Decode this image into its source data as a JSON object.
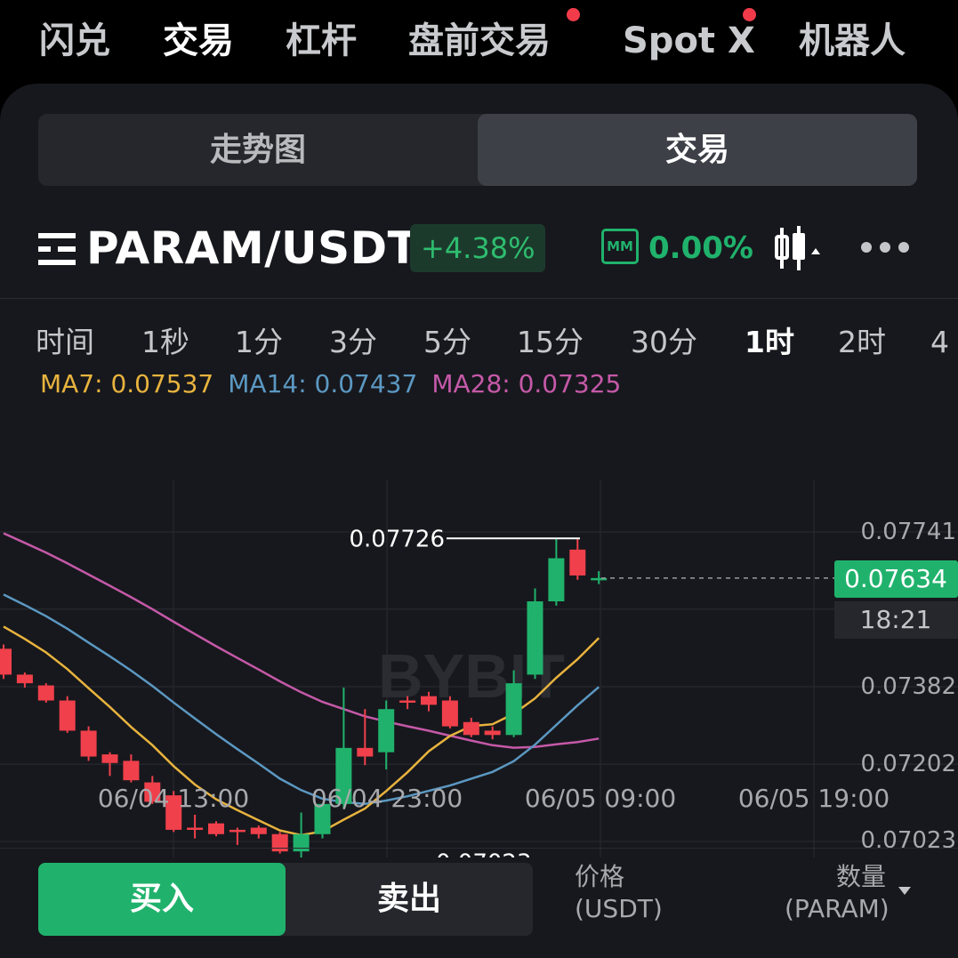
{
  "topnav": {
    "tabs": [
      {
        "label": "闪兑",
        "active": false,
        "dot": false
      },
      {
        "label": "交易",
        "active": true,
        "dot": false
      },
      {
        "label": "杠杆",
        "active": false,
        "dot": false
      },
      {
        "label": "盘前交易",
        "active": false,
        "dot": true
      },
      {
        "label": "Spot X",
        "active": false,
        "dot": true
      },
      {
        "label": "机器人",
        "active": false,
        "dot": false
      }
    ]
  },
  "segment": {
    "left": "走势图",
    "right": "交易",
    "selected": "交易"
  },
  "symbol": {
    "pair": "PARAM/USDT",
    "change": "+4.38%",
    "mm_label": "MM",
    "mm_value": "0.00%"
  },
  "intervals": {
    "items": [
      "时间",
      "1秒",
      "1分",
      "3分",
      "5分",
      "15分",
      "30分",
      "1时",
      "2时",
      "4"
    ],
    "selected": "1时"
  },
  "ma": {
    "ma7": "MA7: 0.07537",
    "ma14": "MA14: 0.07437",
    "ma28": "MA28: 0.07325",
    "colors": {
      "ma7": "#e8b33e",
      "ma14": "#5b98c2",
      "ma28": "#c559a8"
    }
  },
  "colors": {
    "up": "#20b26c",
    "down": "#f0404b",
    "accent_green": "#20b26c"
  },
  "chart_data": {
    "type": "candlestick",
    "price_axis_labels": [
      "0.07741",
      "0.07382",
      "0.07202",
      "0.07023"
    ],
    "current_price": "0.07634",
    "countdown": "18:21",
    "high_marker": "0.07726",
    "low_marker": "0.07023",
    "time_labels": [
      "06/04 13:00",
      "06/04 23:00",
      "06/05 09:00",
      "06/05 19:00"
    ],
    "watermark": "BYBIT",
    "candles": [
      {
        "o": 0.0747,
        "h": 0.0748,
        "c": 0.0741,
        "l": 0.074
      },
      {
        "o": 0.0741,
        "h": 0.07415,
        "c": 0.0739,
        "l": 0.0738
      },
      {
        "o": 0.07385,
        "h": 0.0739,
        "c": 0.0735,
        "l": 0.07345
      },
      {
        "o": 0.0735,
        "h": 0.0736,
        "c": 0.0728,
        "l": 0.07275
      },
      {
        "o": 0.0728,
        "h": 0.0729,
        "c": 0.0722,
        "l": 0.0721
      },
      {
        "o": 0.07225,
        "h": 0.0723,
        "c": 0.07205,
        "l": 0.07175
      },
      {
        "o": 0.0721,
        "h": 0.07225,
        "c": 0.07165,
        "l": 0.0716
      },
      {
        "o": 0.0716,
        "h": 0.07175,
        "c": 0.07115,
        "l": 0.0711
      },
      {
        "o": 0.0713,
        "h": 0.0714,
        "c": 0.0705,
        "l": 0.07045
      },
      {
        "o": 0.07055,
        "h": 0.07085,
        "c": 0.0705,
        "l": 0.0703
      },
      {
        "o": 0.07065,
        "h": 0.0707,
        "c": 0.0704,
        "l": 0.07035
      },
      {
        "o": 0.0705,
        "h": 0.07055,
        "c": 0.07045,
        "l": 0.07015
      },
      {
        "o": 0.07055,
        "h": 0.0706,
        "c": 0.0704,
        "l": 0.0703
      },
      {
        "o": 0.0704,
        "h": 0.07045,
        "c": 0.07,
        "l": 0.06995
      },
      {
        "o": 0.07,
        "h": 0.0709,
        "c": 0.0704,
        "l": 0.06975
      },
      {
        "o": 0.0704,
        "h": 0.0711,
        "c": 0.0711,
        "l": 0.0703
      },
      {
        "o": 0.0711,
        "h": 0.0738,
        "c": 0.0724,
        "l": 0.071
      },
      {
        "o": 0.0724,
        "h": 0.0733,
        "c": 0.0722,
        "l": 0.072
      },
      {
        "o": 0.0723,
        "h": 0.0735,
        "c": 0.0733,
        "l": 0.0719
      },
      {
        "o": 0.0735,
        "h": 0.0736,
        "c": 0.07345,
        "l": 0.0733
      },
      {
        "o": 0.0736,
        "h": 0.0737,
        "c": 0.0734,
        "l": 0.07325
      },
      {
        "o": 0.0735,
        "h": 0.0736,
        "c": 0.0729,
        "l": 0.07285
      },
      {
        "o": 0.073,
        "h": 0.0731,
        "c": 0.0727,
        "l": 0.07265
      },
      {
        "o": 0.0728,
        "h": 0.0729,
        "c": 0.0727,
        "l": 0.0726
      },
      {
        "o": 0.0727,
        "h": 0.0742,
        "c": 0.0739,
        "l": 0.07265
      },
      {
        "o": 0.0741,
        "h": 0.0761,
        "c": 0.0758,
        "l": 0.074
      },
      {
        "o": 0.0758,
        "h": 0.07726,
        "c": 0.0768,
        "l": 0.0757
      },
      {
        "o": 0.077,
        "h": 0.07726,
        "c": 0.0764,
        "l": 0.0763
      },
      {
        "o": 0.07634,
        "h": 0.0765,
        "c": 0.07634,
        "l": 0.0762
      }
    ]
  },
  "trade": {
    "buy_label": "买入",
    "sell_label": "卖出",
    "price_header_1": "价格",
    "price_header_2": "(USDT)",
    "qty_header_1": "数量",
    "qty_header_2": "(PARAM)"
  }
}
